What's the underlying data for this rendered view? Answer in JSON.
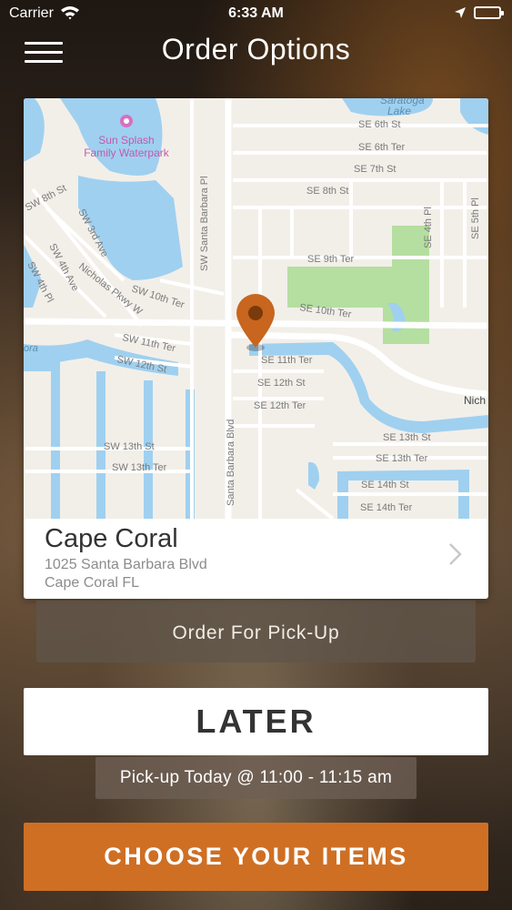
{
  "status_bar": {
    "carrier": "Carrier",
    "time": "6:33 AM"
  },
  "nav": {
    "title": "Order Options"
  },
  "location": {
    "name": "Cape Coral",
    "address_line1": "1025 Santa Barbara Blvd",
    "address_line2": "Cape Coral FL",
    "map_labels": {
      "poi": "Sun Splash\nFamily Waterpark",
      "lake": "Saratoga\nLake",
      "santa_barbara_pl": "SW Santa Barbara Pl",
      "santa_barbara_blvd": "Santa Barbara Blvd",
      "se_6th_st": "SE 6th St",
      "se_6th_ter": "SE 6th Ter",
      "se_7th_st": "SE 7th St",
      "se_8th_st": "SE 8th St",
      "se_9th_ter": "SE 9th Ter",
      "se_10th_ter": "SE 10th Ter",
      "se_11th_ter": "SE 11th Ter",
      "se_12th_st": "SE 12th St",
      "se_12th_ter": "SE 12th Ter",
      "se_13th_st": "SE 13th St",
      "se_13th_ter": "SE 13th Ter",
      "se_14th_st": "SE 14th St",
      "se_14th_ter": "SE 14th Ter",
      "se_4th_pl": "SE 4th Pl",
      "se_5th_pl": "SE 5th Pl",
      "sw_8th_st": "SW 8th St",
      "sw_3rd_ave": "SW 3rd Ave",
      "sw_4th_ave": "SW 4th Ave",
      "sw_4th_pl": "SW 4th Pl",
      "nicholas_pkwy": "Nicholas Pkwy W",
      "sw_10th_ter": "SW 10th Ter",
      "sw_11th_ter": "SW 11th Ter",
      "sw_12th_st": "SW 12th St",
      "sw_13th_st": "SW 13th St",
      "sw_13th_ter": "SW 13th Ter",
      "nich": "Nich",
      "ora": "ora"
    }
  },
  "actions": {
    "pickup_label": "Order For Pick-Up",
    "later_label": "LATER",
    "pickup_time": "Pick-up Today @ 11:00 - 11:15 am",
    "choose_items": "CHOOSE YOUR ITEMS"
  },
  "colors": {
    "accent": "#CF6F24",
    "pin": "#C8651E",
    "water": "#9FD0F0",
    "park": "#B5DFA0"
  },
  "icons": [
    "wifi-icon",
    "location-arrow-icon",
    "battery-icon",
    "hamburger-menu-icon",
    "map-pin-icon",
    "chevron-right-icon",
    "poi-icon"
  ]
}
